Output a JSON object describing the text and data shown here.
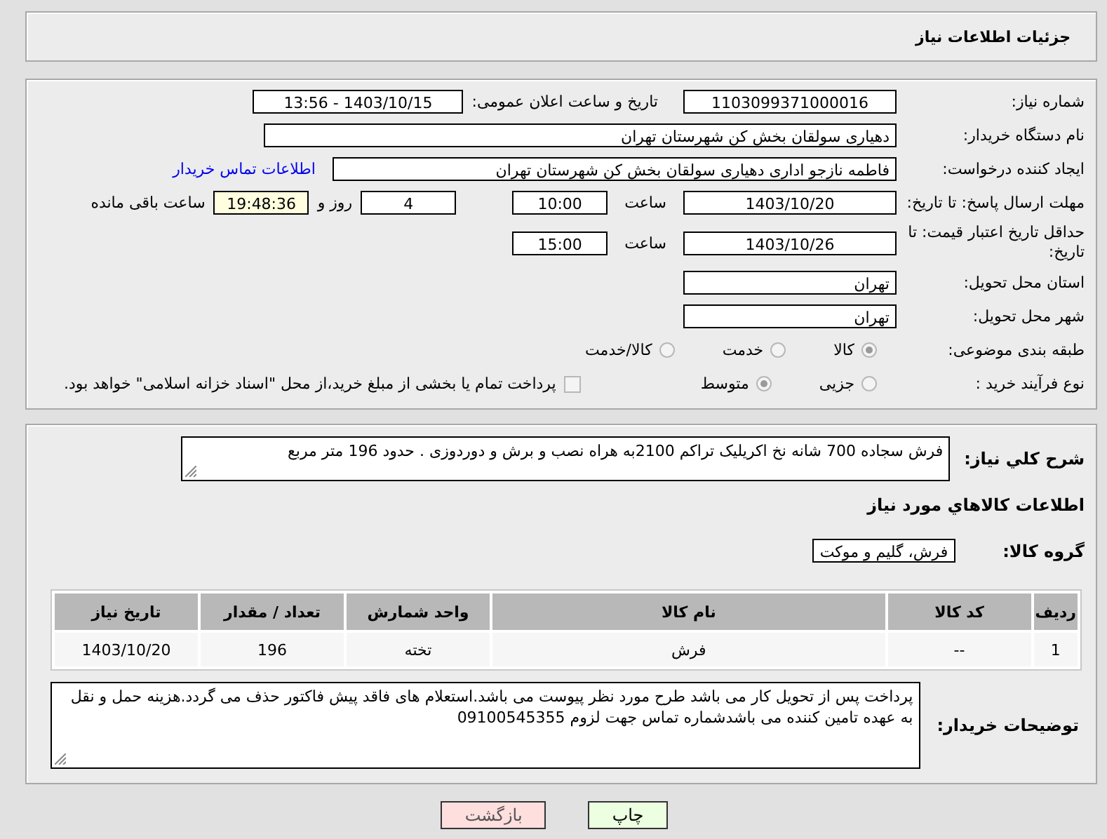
{
  "page_title": "جزئیات اطلاعات نیاز",
  "need_number": {
    "label": "شماره نیاز:",
    "value": "1103099371000016"
  },
  "announce_datetime": {
    "label": "تاریخ و ساعت اعلان عمومی:",
    "value": "1403/10/15 - 13:56"
  },
  "buyer_org": {
    "label": "نام دستگاه خریدار:",
    "value": "دهیاری سولقان بخش کن شهرستان تهران"
  },
  "requester": {
    "label": "ایجاد کننده درخواست:",
    "value": "فاطمه نازجو اداری دهیاری سولقان بخش کن شهرستان تهران",
    "link": "اطلاعات تماس خریدار"
  },
  "reply_deadline": {
    "label": "مهلت ارسال پاسخ: تا تاریخ:",
    "date": "1403/10/20",
    "time_label": "ساعت",
    "time": "10:00",
    "days": "4",
    "days_label": "روز و",
    "remaining": "19:48:36",
    "remaining_label": "ساعت باقی مانده"
  },
  "price_validity": {
    "label": "حداقل تاریخ اعتبار قیمت: تا تاریخ:",
    "date": "1403/10/26",
    "time_label": "ساعت",
    "time": "15:00"
  },
  "delivery_province": {
    "label": "استان محل تحویل:",
    "value": "تهران"
  },
  "delivery_city": {
    "label": "شهر محل تحویل:",
    "value": "تهران"
  },
  "subject_category": {
    "label": "طبقه بندی موضوعی:",
    "options": [
      {
        "label": "کالا",
        "selected": true
      },
      {
        "label": "خدمت",
        "selected": false
      },
      {
        "label": "کالا/خدمت",
        "selected": false
      }
    ]
  },
  "purchase_process": {
    "label": "نوع فرآیند خرید :",
    "options": [
      {
        "label": "جزیی",
        "selected": false
      },
      {
        "label": "متوسط",
        "selected": true
      }
    ],
    "treasury": {
      "label": "پرداخت تمام یا بخشی از مبلغ خرید،از محل \"اسناد خزانه اسلامی\" خواهد بود.",
      "checked": false
    }
  },
  "description": {
    "label": "شرح کلي نياز:",
    "value": "فرش سجاده 700 شانه نخ اکریلیک تراکم 2100به هراه نصب و برش و دوردوزی . حدود 196 متر مربع"
  },
  "goods_heading": "اطلاعات كالاهاي مورد نياز",
  "goods_group": {
    "label": "گروه کالا:",
    "value": "فرش، گلیم و موکت"
  },
  "table": {
    "columns": [
      "ردیف",
      "کد کالا",
      "نام کالا",
      "واحد شمارش",
      "تعداد / مقدار",
      "تاریخ نیاز"
    ],
    "rows": [
      [
        "1",
        "--",
        "فرش",
        "تخته",
        "196",
        "1403/10/20"
      ]
    ]
  },
  "buyer_notes": {
    "label": "توضیحات خریدار:",
    "value": "پرداخت پس از تحویل کار می باشد طرح مورد نظر پیوست می باشد.استعلام های فاقد پیش فاکتور حذف می گردد.هزینه حمل و نقل به عهده تامین کننده می باشدشماره تماس جهت لزوم 09100545355"
  },
  "buttons": [
    {
      "label": "چاپ",
      "kind": "print"
    },
    {
      "label": "بازگشت",
      "kind": "back"
    }
  ]
}
